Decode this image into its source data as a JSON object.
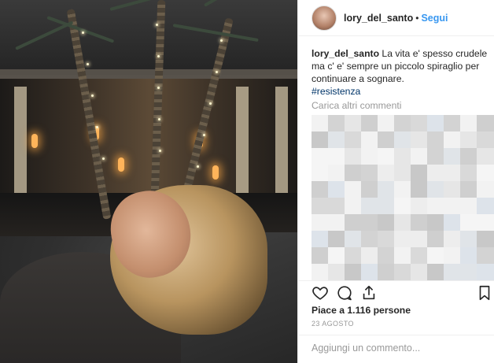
{
  "post": {
    "username": "lory_del_santo",
    "follow_label": "Segui",
    "separator": "•"
  },
  "caption": {
    "username": "lory_del_santo",
    "text": "La vita e' spesso crudele ma c' e' sempre un piccolo spiraglio per continuare a sognare.",
    "hashtag": "#resistenza"
  },
  "comments": {
    "load_more_label": "Carica altri commenti",
    "blurred": true
  },
  "actions": {
    "icons": [
      "heart-icon",
      "comment-icon",
      "share-icon",
      "bookmark-icon"
    ]
  },
  "likes": {
    "text": "Piace a 1.116 persone"
  },
  "date": {
    "text": "23 AGOSTO"
  },
  "comment_box": {
    "placeholder": "Aggiungi un commento..."
  },
  "colors": {
    "link": "#3897f0",
    "hashtag": "#003569",
    "muted": "#999999",
    "text": "#262626"
  }
}
